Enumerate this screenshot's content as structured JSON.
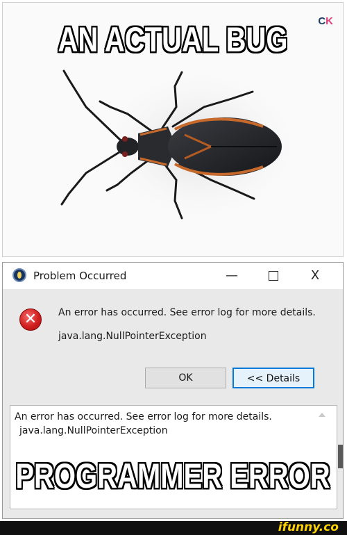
{
  "meme": {
    "top_caption": "AN ACTUAL BUG",
    "bottom_caption": "PROGRAMMER ERROR"
  },
  "watermark": {
    "corner_logo": "C",
    "corner_logo_accent": "K"
  },
  "dialog": {
    "title": "Problem Occurred",
    "icon": "eclipse-app-icon",
    "window_buttons": {
      "minimize": "—",
      "close": "X"
    },
    "error_icon": "error-x-icon",
    "message": "An error has occurred. See error log for more details.",
    "exception": "java.lang.NullPointerException",
    "ok_label": "OK",
    "details_label": "<< Details",
    "details_text_line1": "An error has occurred. See error log for more details.",
    "details_text_line2": "java.lang.NullPointerException"
  },
  "footer": {
    "site_logo": "ifunny.co"
  },
  "colors": {
    "dialog_bg": "#e9e9e9",
    "accent_blue": "#0078d7",
    "error_red": "#d21f1f",
    "footer_bg": "#101010",
    "footer_logo": "#ffd200"
  }
}
